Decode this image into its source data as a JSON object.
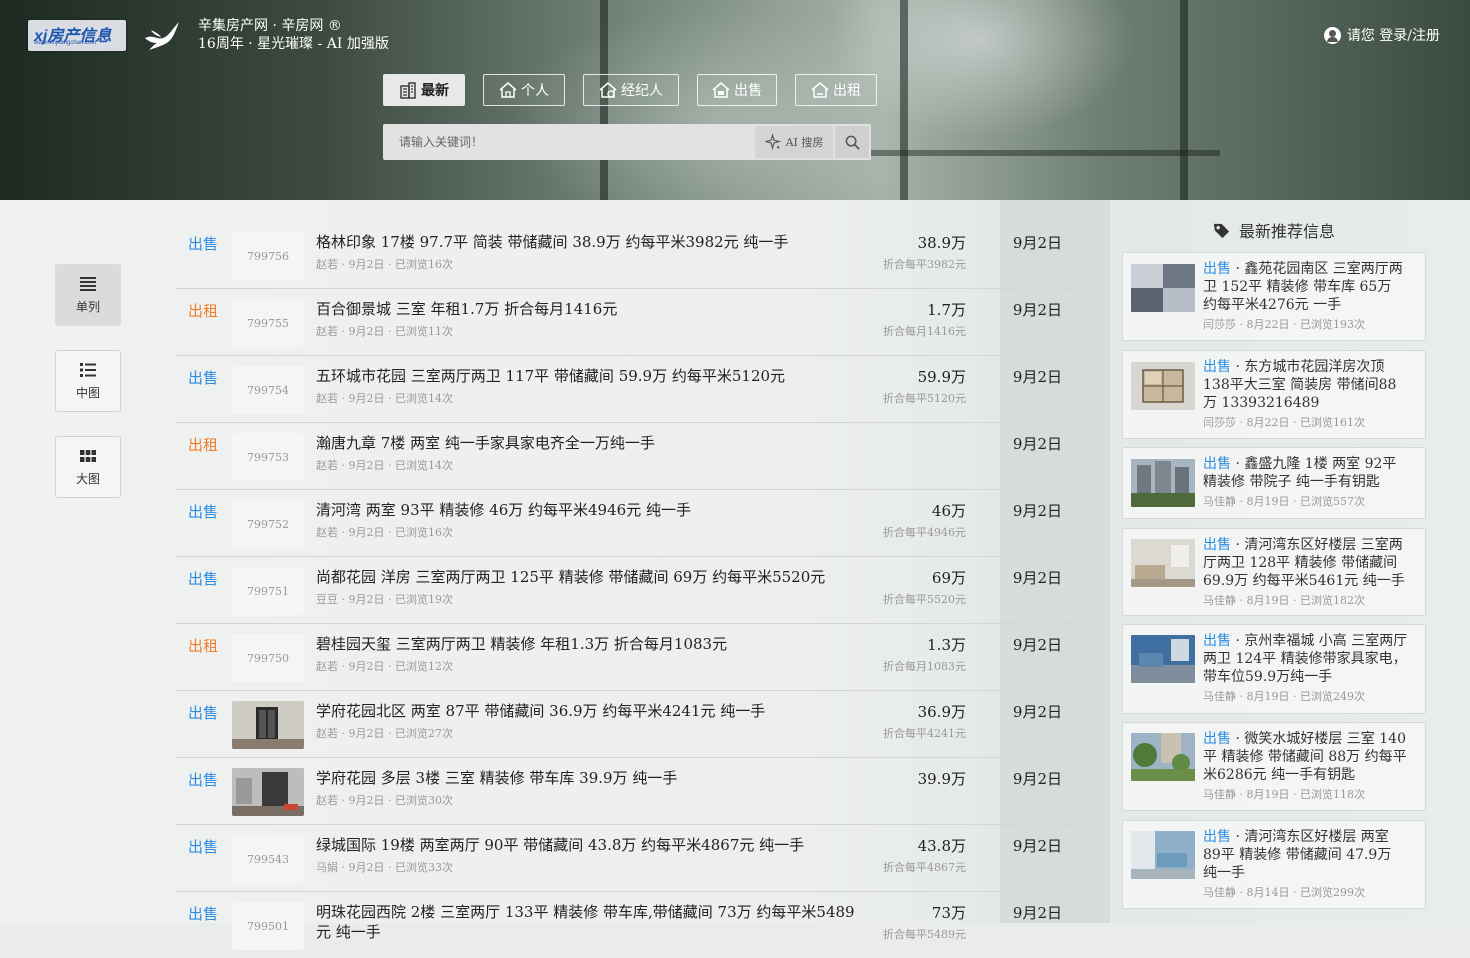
{
  "header": {
    "logo_text": "xj房产信息",
    "logo_url": "www.xinjifangchan.com",
    "site_name": "辛集房产网 · 辛房网 ®",
    "site_sub": "16周年 · 星光璀璨 - AI 加强版",
    "login": "请您 登录/注册"
  },
  "tabs": [
    {
      "label": "最新",
      "icon": "building-icon",
      "active": true
    },
    {
      "label": "个人",
      "icon": "house-icon",
      "active": false
    },
    {
      "label": "经纪人",
      "icon": "agent-house-icon",
      "active": false
    },
    {
      "label": "出售",
      "icon": "sale-house-icon",
      "active": false
    },
    {
      "label": "出租",
      "icon": "rent-house-icon",
      "active": false
    }
  ],
  "search": {
    "placeholder": "请输入关键词！",
    "ai_label": "AI 搜房"
  },
  "views": [
    {
      "label": "单列",
      "icon": "list-icon",
      "active": true
    },
    {
      "label": "中图",
      "icon": "list-thumb-icon",
      "active": false
    },
    {
      "label": "大图",
      "icon": "grid-icon",
      "active": false
    }
  ],
  "listings": [
    {
      "type": "出售",
      "kind": "sale",
      "id": "799756",
      "title": "格林印象 17楼 97.7平 简装 带储藏间 38.9万 约每平米3982元 纯一手",
      "meta": "赵若 · 9月2日 · 已浏览16次",
      "price": "38.9万",
      "unit": "折合每平3982元",
      "date": "9月2日",
      "photo": false
    },
    {
      "type": "出租",
      "kind": "rent",
      "id": "799755",
      "title": "百合御景城 三室 年租1.7万 折合每月1416元",
      "meta": "赵若 · 9月2日 · 已浏览11次",
      "price": "1.7万",
      "unit": "折合每月1416元",
      "date": "9月2日",
      "photo": false
    },
    {
      "type": "出售",
      "kind": "sale",
      "id": "799754",
      "title": "五环城市花园 三室两厅两卫 117平 带储藏间 59.9万 约每平米5120元",
      "meta": "赵若 · 9月2日 · 已浏览14次",
      "price": "59.9万",
      "unit": "折合每平5120元",
      "date": "9月2日",
      "photo": false
    },
    {
      "type": "出租",
      "kind": "rent",
      "id": "799753",
      "title": "瀚唐九章 7楼 两室 纯一手家具家电齐全一万纯一手",
      "meta": "赵若 · 9月2日 · 已浏览14次",
      "price": "",
      "unit": "",
      "date": "9月2日",
      "photo": false
    },
    {
      "type": "出售",
      "kind": "sale",
      "id": "799752",
      "title": "清河湾 两室 93平 精装修 46万 约每平米4946元 纯一手",
      "meta": "赵若 · 9月2日 · 已浏览16次",
      "price": "46万",
      "unit": "折合每平4946元",
      "date": "9月2日",
      "photo": false
    },
    {
      "type": "出售",
      "kind": "sale",
      "id": "799751",
      "title": "尚都花园 洋房 三室两厅两卫 125平 精装修 带储藏间 69万 约每平米5520元",
      "meta": "豆豆 · 9月2日 · 已浏览19次",
      "price": "69万",
      "unit": "折合每平5520元",
      "date": "9月2日",
      "photo": false
    },
    {
      "type": "出租",
      "kind": "rent",
      "id": "799750",
      "title": "碧桂园天玺 三室两厅两卫 精装修 年租1.3万 折合每月1083元",
      "meta": "赵若 · 9月2日 · 已浏览12次",
      "price": "1.3万",
      "unit": "折合每月1083元",
      "date": "9月2日",
      "photo": false
    },
    {
      "type": "出售",
      "kind": "sale",
      "id": "",
      "title": "学府花园北区 两室 87平 带储藏间 36.9万 约每平米4241元 纯一手",
      "meta": "赵若 · 9月2日 · 已浏览27次",
      "price": "36.9万",
      "unit": "折合每平4241元",
      "date": "9月2日",
      "photo": true
    },
    {
      "type": "出售",
      "kind": "sale",
      "id": "",
      "title": "学府花园 多层 3楼 三室 精装修 带车库 39.9万 纯一手",
      "meta": "赵若 · 9月2日 · 已浏览30次",
      "price": "39.9万",
      "unit": "",
      "date": "9月2日",
      "photo": true
    },
    {
      "type": "出售",
      "kind": "sale",
      "id": "799543",
      "title": "绿城国际 19楼 两室两厅 90平 带储藏间 43.8万 约每平米4867元 纯一手",
      "meta": "马娟 · 9月2日 · 已浏览33次",
      "price": "43.8万",
      "unit": "折合每平4867元",
      "date": "9月2日",
      "photo": false
    },
    {
      "type": "出售",
      "kind": "sale",
      "id": "799501",
      "title": "明珠花园西院 2楼 三室两厅 133平 精装修 带车库,带储藏间 73万 约每平米5489元 纯一手",
      "meta": "",
      "price": "73万",
      "unit": "折合每平5489元",
      "date": "9月2日",
      "photo": false
    }
  ],
  "sidebar": {
    "heading": "最新推荐信息",
    "items": [
      {
        "type": "出售",
        "title": " · 鑫苑花园南区 三室两厅两卫 152平 精装修 带车库 65万 约每平米4276元 一手",
        "meta": "闫莎莎 · 8月22日 · 已浏览193次"
      },
      {
        "type": "出售",
        "title": " · 东方城市花园洋房次顶138平大三室 简装房 带储间88万 13393216489",
        "meta": "闫莎莎 · 8月22日 · 已浏览161次"
      },
      {
        "type": "出售",
        "title": " · 鑫盛九隆 1楼 两室 92平 精装修 带院子 纯一手有钥匙",
        "meta": "马佳静 · 8月19日 · 已浏览557次"
      },
      {
        "type": "出售",
        "title": " · 清河湾东区好楼层 三室两厅两卫 128平 精装修 带储藏间 69.9万 约每平米5461元 纯一手",
        "meta": "马佳静 · 8月19日 · 已浏览182次"
      },
      {
        "type": "出售",
        "title": " · 京州幸福城 小高 三室两厅两卫 124平 精装修带家具家电，带车位59.9万纯一手",
        "meta": "马佳静 · 8月19日 · 已浏览249次"
      },
      {
        "type": "出售",
        "title": " · 微笑水城好楼层 三室 140平 精装修 带储藏间 88万 约每平米6286元 纯一手有钥匙",
        "meta": "马佳静 · 8月19日 · 已浏览118次"
      },
      {
        "type": "出售",
        "title": " · 清河湾东区好楼层 两室 89平 精装修 带储藏间 47.9万 纯一手",
        "meta": "马佳静 · 8月14日 · 已浏览299次"
      }
    ]
  },
  "colors": {
    "sale": "#2b8de0",
    "rent": "#f07d2c"
  }
}
